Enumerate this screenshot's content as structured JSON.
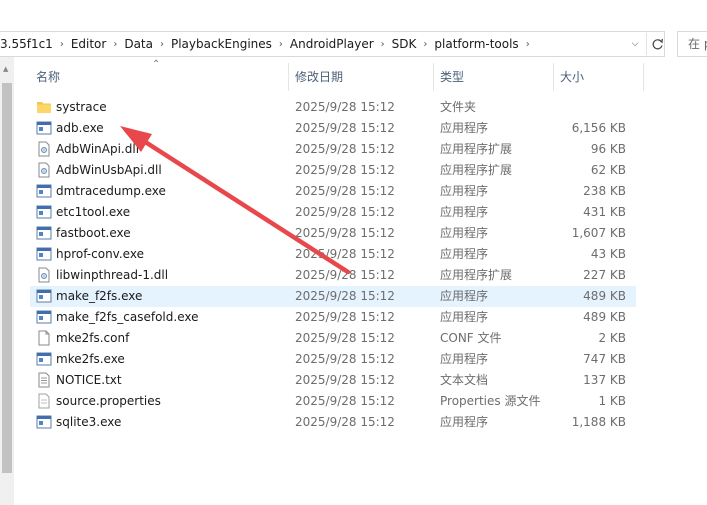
{
  "address_bar": {
    "crumbs": [
      "3.55f1c1",
      "Editor",
      "Data",
      "PlaybackEngines",
      "AndroidPlayer",
      "SDK",
      "platform-tools"
    ]
  },
  "search": {
    "placeholder": "在 platform-tools 中搜索"
  },
  "columns": {
    "name": "名称",
    "date": "修改日期",
    "type": "类型",
    "size": "大小"
  },
  "files": [
    {
      "name": "systrace",
      "date": "2025/9/28 15:12",
      "type": "文件夹",
      "size": "",
      "icon": "folder-icon"
    },
    {
      "name": "adb.exe",
      "date": "2025/9/28 15:12",
      "type": "应用程序",
      "size": "6,156 KB",
      "icon": "exe-icon"
    },
    {
      "name": "AdbWinApi.dll",
      "date": "2025/9/28 15:12",
      "type": "应用程序扩展",
      "size": "96 KB",
      "icon": "dll-icon"
    },
    {
      "name": "AdbWinUsbApi.dll",
      "date": "2025/9/28 15:12",
      "type": "应用程序扩展",
      "size": "62 KB",
      "icon": "dll-icon"
    },
    {
      "name": "dmtracedump.exe",
      "date": "2025/9/28 15:12",
      "type": "应用程序",
      "size": "238 KB",
      "icon": "exe-icon"
    },
    {
      "name": "etc1tool.exe",
      "date": "2025/9/28 15:12",
      "type": "应用程序",
      "size": "431 KB",
      "icon": "exe-icon"
    },
    {
      "name": "fastboot.exe",
      "date": "2025/9/28 15:12",
      "type": "应用程序",
      "size": "1,607 KB",
      "icon": "exe-icon"
    },
    {
      "name": "hprof-conv.exe",
      "date": "2025/9/28 15:12",
      "type": "应用程序",
      "size": "43 KB",
      "icon": "exe-icon"
    },
    {
      "name": "libwinpthread-1.dll",
      "date": "2025/9/28 15:12",
      "type": "应用程序扩展",
      "size": "227 KB",
      "icon": "dll-icon"
    },
    {
      "name": "make_f2fs.exe",
      "date": "2025/9/28 15:12",
      "type": "应用程序",
      "size": "489 KB",
      "icon": "exe-icon",
      "highlighted": true
    },
    {
      "name": "make_f2fs_casefold.exe",
      "date": "2025/9/28 15:12",
      "type": "应用程序",
      "size": "489 KB",
      "icon": "exe-icon"
    },
    {
      "name": "mke2fs.conf",
      "date": "2025/9/28 15:12",
      "type": "CONF 文件",
      "size": "2 KB",
      "icon": "file-icon"
    },
    {
      "name": "mke2fs.exe",
      "date": "2025/9/28 15:12",
      "type": "应用程序",
      "size": "747 KB",
      "icon": "exe-icon"
    },
    {
      "name": "NOTICE.txt",
      "date": "2025/9/28 15:12",
      "type": "文本文档",
      "size": "137 KB",
      "icon": "text-file-icon"
    },
    {
      "name": "source.properties",
      "date": "2025/9/28 15:12",
      "type": "Properties 源文件",
      "size": "1 KB",
      "icon": "properties-file-icon"
    },
    {
      "name": "sqlite3.exe",
      "date": "2025/9/28 15:12",
      "type": "应用程序",
      "size": "1,188 KB",
      "icon": "exe-icon"
    }
  ],
  "annotation": {
    "color": "#e8484b",
    "points_to": "adb.exe"
  }
}
